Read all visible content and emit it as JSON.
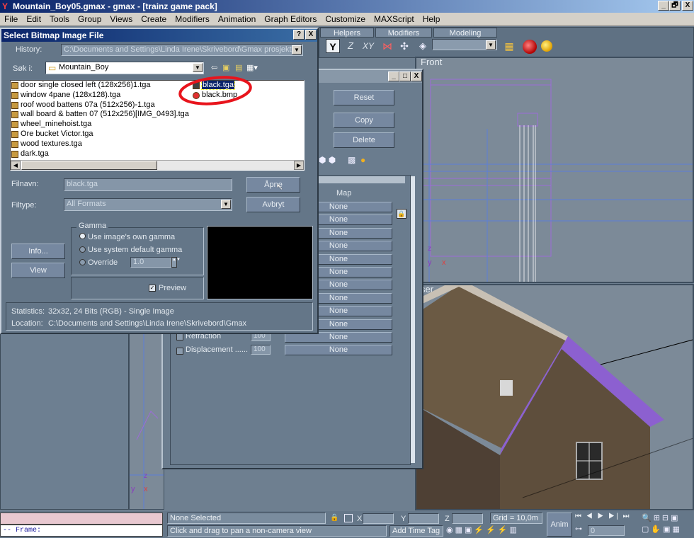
{
  "window": {
    "title": "Mountain_Boy05.gmax - gmax - [trainz game pack]",
    "min": "_",
    "max": "🗗",
    "close": "X"
  },
  "menu": [
    "File",
    "Edit",
    "Tools",
    "Group",
    "Views",
    "Create",
    "Modifiers",
    "Animation",
    "Graph Editors",
    "Customize",
    "MAXScript",
    "Help"
  ],
  "cmd_tabs": [
    "Helpers",
    "Modifiers",
    "Modeling"
  ],
  "toolbar": {
    "axis_y": "Y",
    "axis_z": "Z",
    "axis_xy": "XY"
  },
  "viewports": {
    "front": "Front",
    "user": "ser"
  },
  "axis": {
    "z": "z",
    "y": "y",
    "x": "x"
  },
  "material": {
    "reset": "Reset",
    "copy": "Copy",
    "delete": "Delete",
    "map_header": "Map",
    "map_rows": [
      "None",
      "None",
      "None",
      "None",
      "None",
      "None",
      "None",
      "None",
      "None",
      "None",
      "None",
      "None"
    ],
    "refraction": {
      "label": "Refraction",
      "value": "100"
    },
    "displacement": {
      "label": "Displacement ......",
      "value": "100"
    }
  },
  "dialog": {
    "title": "Select Bitmap Image File",
    "help": "?",
    "close": "X",
    "history_label": "History:",
    "history_value": "C:\\Documents and Settings\\Linda Irene\\Skrivebord\\Gmax prosjekter\\",
    "look_in_label": "Søk i:",
    "look_in_value": "Mountain_Boy",
    "files_col1": [
      "door single closed left (128x256)1.tga",
      "window 4pane (128x128).tga",
      "roof wood battens 07a (512x256)-1.tga",
      "wall board & batten 07 (512x256)[IMG_0493].tga",
      "wheel_minehoist.tga",
      "Ore bucket Victor.tga",
      "wood textures.tga",
      "dark.tga"
    ],
    "files_col2": [
      "black.tga",
      "black.bmp"
    ],
    "filename_label": "Filnavn:",
    "filename_value": "black.tga",
    "filetype_label": "Filtype:",
    "filetype_value": "All Formats",
    "open_button": "Åpne",
    "cancel_button": "Avbryt",
    "gamma_group": "Gamma",
    "gamma_opt1": "Use image's own gamma",
    "gamma_opt2": "Use system default gamma",
    "gamma_opt3": "Override",
    "override_value": "1.0",
    "info_button": "Info...",
    "view_button": "View",
    "preview_label": "Preview",
    "stats_label": "Statistics:",
    "stats_value": "32x32, 24 Bits (RGB) - Single Image",
    "location_label": "Location:",
    "location_value": "C:\\Documents and Settings\\Linda Irene\\Skrivebord\\Gmax"
  },
  "status": {
    "frame": "-- Frame:",
    "none_selected": "None Selected",
    "x_label": "X",
    "y_label": "Y",
    "z_label": "Z",
    "grid": "Grid = 10,0m",
    "anim": "Anim",
    "hint": "Click and drag to pan a non-camera view",
    "add_time_tag": "Add Time Tag",
    "frame_value": "0"
  },
  "colors": {
    "title_blue": "#0a246a",
    "annotation_red": "#e8141c",
    "wire_purple": "#9c6cd8"
  }
}
